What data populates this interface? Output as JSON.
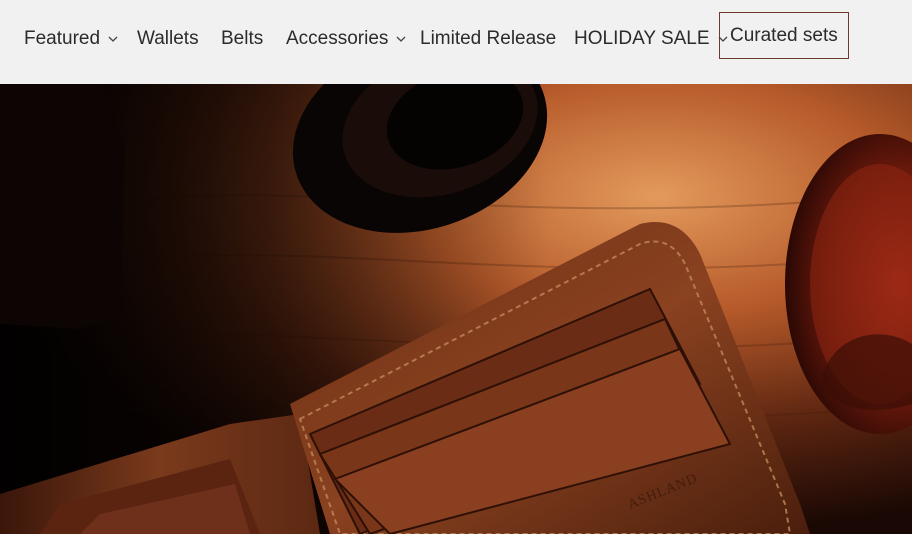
{
  "nav": {
    "items": [
      {
        "label": "Featured",
        "has_dropdown": true
      },
      {
        "label": "Wallets",
        "has_dropdown": false
      },
      {
        "label": "Belts",
        "has_dropdown": false
      },
      {
        "label": "Accessories",
        "has_dropdown": true
      },
      {
        "label": "Limited Release",
        "has_dropdown": false
      },
      {
        "label": "HOLIDAY SALE",
        "has_dropdown": true
      },
      {
        "label": "Curated sets",
        "has_dropdown": false,
        "highlighted": true
      }
    ],
    "highlight_border_color": "#6b3a2e"
  },
  "hero": {
    "description_icon": "leather-wallet-photo",
    "brand_stamp": "ASHLAND"
  },
  "colors": {
    "nav_background": "#f1f1f1",
    "nav_text": "#2b2b2b",
    "leather": "#7a3a1c",
    "wood": "#c4703a"
  }
}
